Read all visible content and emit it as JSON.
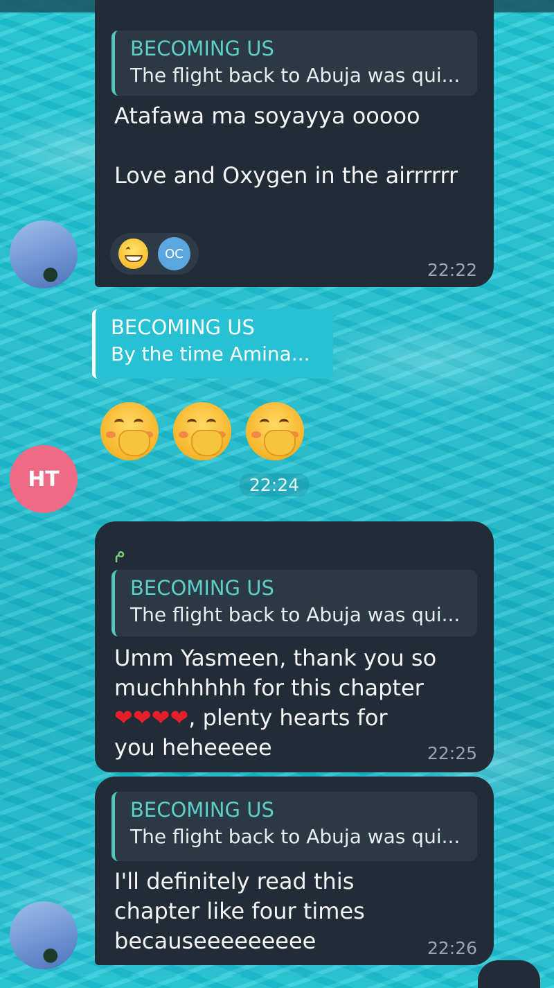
{
  "messages": [
    {
      "reply_title": "BECOMING US",
      "reply_text": "The flight back to Abuja was qui...",
      "text": "Atafawa ma soyayya ooooo\n\nLove and Oxygen in the airrrrrr",
      "reaction_avatar": "OC",
      "time": "22:22"
    },
    {
      "reply_title": "BECOMING US",
      "reply_text": "By the time Amina...",
      "time": "22:24",
      "sender_initials": "HT"
    },
    {
      "sender_mark": "م",
      "reply_title": "BECOMING US",
      "reply_text": "The flight back to Abuja was qui...",
      "text_line1": "Umm Yasmeen, thank you so",
      "text_line2": "muchhhhhh for this chapter",
      "hearts": "❤❤❤❤",
      "text_line3": ", plenty hearts for",
      "text_line4": "you heheeeee",
      "time": "22:25"
    },
    {
      "reply_title": "BECOMING US",
      "reply_text": "The flight back to Abuja was qui...",
      "text": "I'll definitely read this\nchapter like four times\nbecauseeeeeeeee",
      "time": "22:26"
    }
  ],
  "colors": {
    "bubble": "#222c37",
    "reply_accent": "#54c7c0",
    "avatar_ht": "#ee6b85",
    "water": "#1fc9d6"
  }
}
